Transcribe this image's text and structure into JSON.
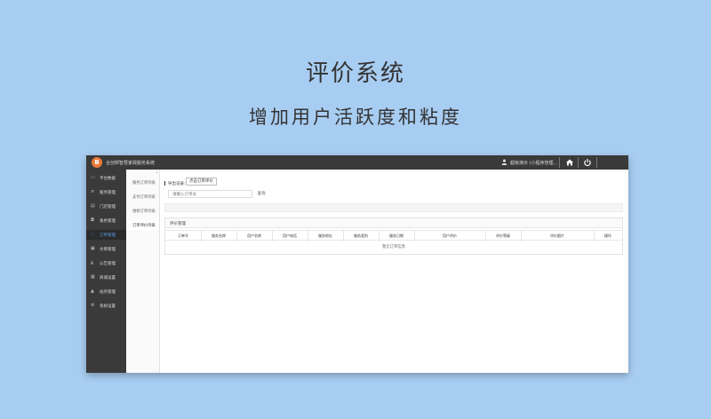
{
  "hero": {
    "title": "评价系统",
    "subtitle": "增加用户活跃度和粘度"
  },
  "topbar": {
    "logo_char": "B",
    "app_title": "合创邦智慧家政服务系统",
    "user_text": "超级演示 (小程序管理...",
    "icons": [
      "user-icon",
      "home-icon",
      "power-icon"
    ]
  },
  "sidebar": {
    "items": [
      {
        "label": "平台数据",
        "icon": "monitor-icon",
        "glyph": "▭"
      },
      {
        "label": "服务管理",
        "icon": "list-icon",
        "glyph": "≡"
      },
      {
        "label": "门店管理",
        "icon": "store-icon",
        "glyph": "▤"
      },
      {
        "label": "角色管理",
        "icon": "role-icon",
        "glyph": "◘"
      },
      {
        "label": "订单管理",
        "icon": "order-icon",
        "glyph": "◌"
      },
      {
        "label": "文章管理",
        "icon": "article-icon",
        "glyph": "▣"
      },
      {
        "label": "公告管理",
        "icon": "notice-icon",
        "glyph": "◭"
      },
      {
        "label": "商城设置",
        "icon": "shop-icon",
        "glyph": "▦"
      },
      {
        "label": "站务管理",
        "icon": "station-icon",
        "glyph": "▲"
      },
      {
        "label": "系统设置",
        "icon": "settings-icon",
        "glyph": "⚙"
      }
    ],
    "active_index": 4
  },
  "subnav": {
    "items": [
      "服务订单列表",
      "支付订单列表",
      "维修订单列表",
      "订单评价列表"
    ],
    "active_index": 3
  },
  "filter": {
    "label": "导出记录:",
    "export_label": "点击订单评价",
    "search_placeholder": "请输入订单号",
    "search_label": "查询"
  },
  "panel": {
    "title": "评价管理",
    "columns": [
      "订单号",
      "服务名称",
      "用户名称",
      "用户电话",
      "服务地址",
      "服务类别",
      "服务日期",
      "用户评价",
      "评价等级",
      "评价图片",
      "操作"
    ],
    "empty_text": "暂无订单信息"
  },
  "colors": {
    "page_bg": "#a8cdf2",
    "topbar_bg": "#3a3a3a",
    "sidebar_bg": "#3a3a3a",
    "logo": "#e8793a",
    "active_link": "#5aa0e8"
  }
}
